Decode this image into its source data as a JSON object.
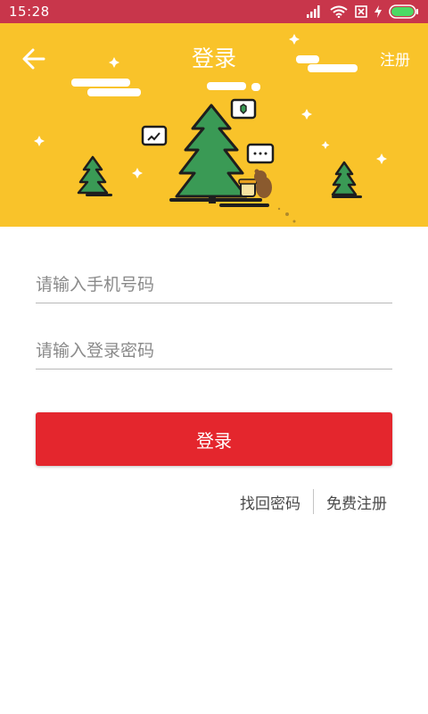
{
  "status_bar": {
    "time": "15:28",
    "icons": [
      "signal-icon",
      "wifi-icon",
      "sim-off-icon",
      "charging-icon",
      "battery-icon"
    ]
  },
  "header": {
    "title": "登录",
    "back_icon": "arrow-left-icon",
    "register_label": "注册"
  },
  "form": {
    "phone_placeholder": "请输入手机号码",
    "phone_value": "",
    "password_placeholder": "请输入登录密码",
    "password_value": "",
    "login_label": "登录"
  },
  "links": {
    "forgot_password": "找回密码",
    "free_register": "免费注册"
  },
  "colors": {
    "status_bar": "#c8364b",
    "hero_background": "#f9c32a",
    "primary_button": "#e4262d",
    "tree_green": "#3a9a55"
  }
}
